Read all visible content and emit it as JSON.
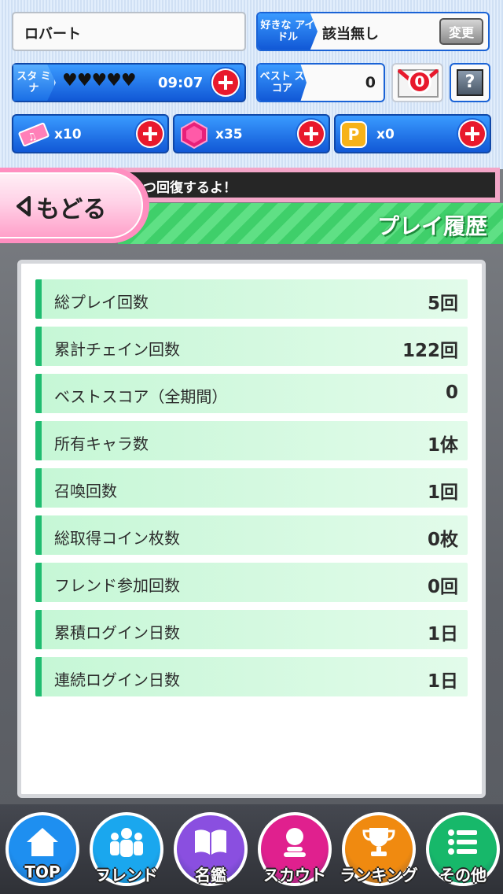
{
  "header": {
    "player_name": "ロバート",
    "favorite_idol_tag": "好きな アイドル",
    "favorite_idol_value": "該当無し",
    "change_label": "変更",
    "stamina_tag": "スタ ミナ",
    "stamina_hearts": "♥♥♥♥♥",
    "stamina_timer": "09:07",
    "best_score_tag": "ベスト スコア",
    "best_score_value": "0",
    "mail_count": "0",
    "help_label": "?"
  },
  "currencies": [
    {
      "icon": "ticket-icon",
      "count": "x10"
    },
    {
      "icon": "gem-icon",
      "count": "x35"
    },
    {
      "icon": "point-coin-icon",
      "count": "x0"
    }
  ],
  "ticker_text": "つ回復するよ！",
  "back_label": "もどる",
  "section_title": "プレイ履歴",
  "stats": [
    {
      "label": "総プレイ回数",
      "value": "5回"
    },
    {
      "label": "累計チェイン回数",
      "value": "122回"
    },
    {
      "label": "ベストスコア（全期間）",
      "value": "0"
    },
    {
      "label": "所有キャラ数",
      "value": "1体"
    },
    {
      "label": "召喚回数",
      "value": "1回"
    },
    {
      "label": "総取得コイン枚数",
      "value": "0枚"
    },
    {
      "label": "フレンド参加回数",
      "value": "0回"
    },
    {
      "label": "累積ログイン日数",
      "value": "1日"
    },
    {
      "label": "連続ログイン日数",
      "value": "1日"
    }
  ],
  "nav": [
    {
      "label": "TOP",
      "icon": "home-icon",
      "color": "#1e8ff0"
    },
    {
      "label": "フレンド",
      "icon": "friends-icon",
      "color": "#1aa7ee"
    },
    {
      "label": "名鑑",
      "icon": "book-icon",
      "color": "#8a4fe0"
    },
    {
      "label": "スカウト",
      "icon": "scout-icon",
      "color": "#e0208e"
    },
    {
      "label": "ランキング",
      "icon": "trophy-icon",
      "color": "#f08a10"
    },
    {
      "label": "その他",
      "icon": "menu-list-icon",
      "color": "#17b86a"
    }
  ],
  "colors": {
    "accent_green": "#1fbc70",
    "row_bg": "#c6f7d6",
    "plus_red": "#e8192c",
    "ui_blue": "#1a63d6"
  }
}
